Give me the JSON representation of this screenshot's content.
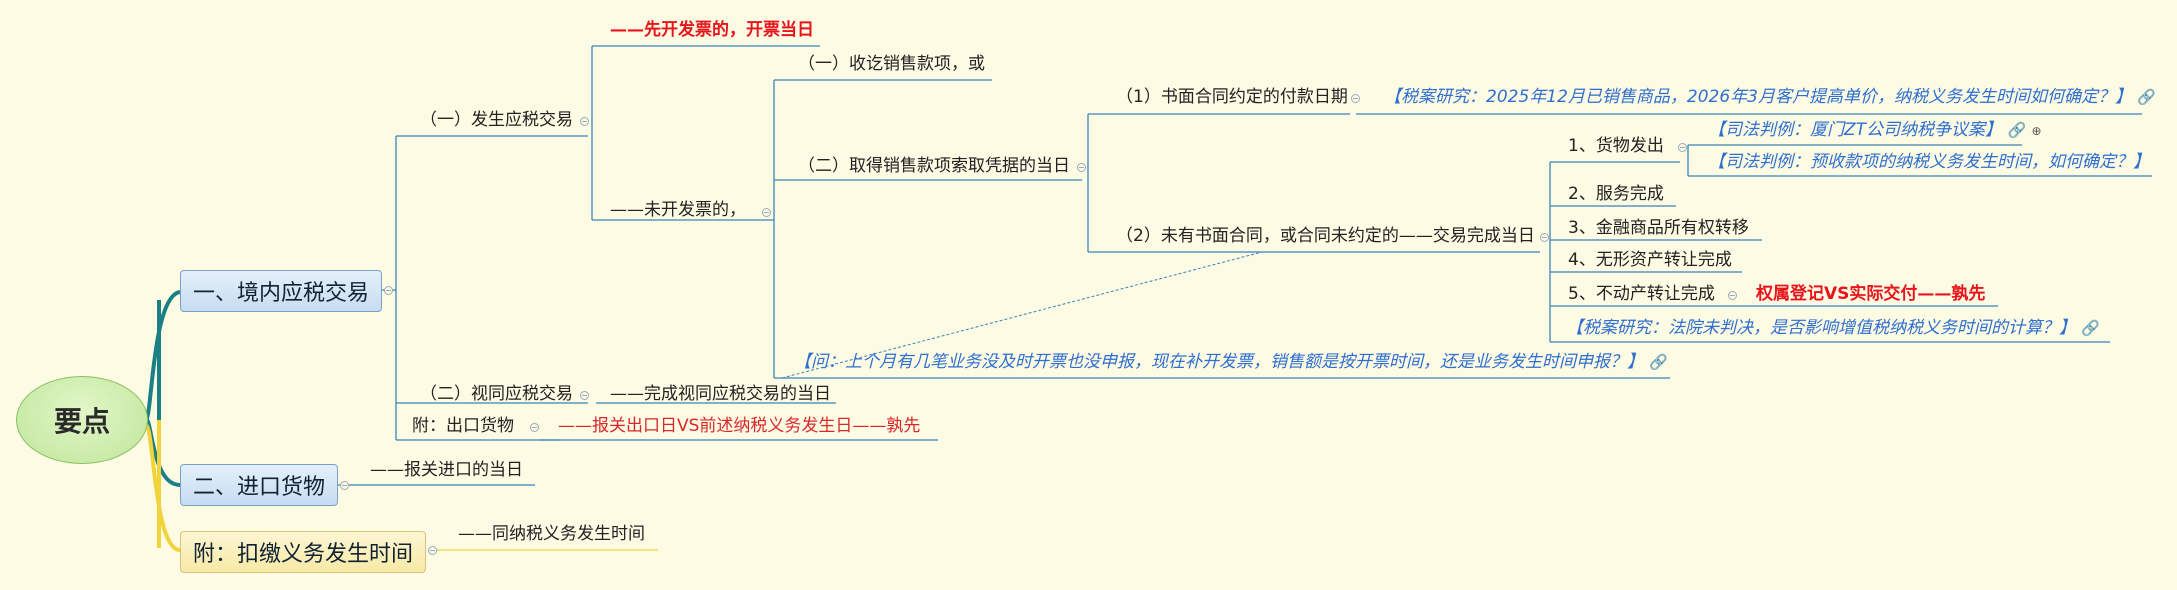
{
  "root": {
    "label": "要点"
  },
  "colors": {
    "blue_line": "#3b84b8",
    "teal_line": "#1b7f86",
    "yellow_line": "#f0d43a",
    "red": "#e8141c",
    "note_blue": "#2e6fd0"
  },
  "topics": {
    "domestic": "一、境内应税交易",
    "import": "二、进口货物",
    "withholding": "附：扣缴义务发生时间"
  },
  "domestic": {
    "occur": "（一）发生应税交易",
    "invoiced_first": "——先开发票的，开票当日",
    "not_invoiced": "——未开发票的，",
    "received": "（一）收讫销售款项，或",
    "obtained": "（二）取得销售款项索取凭据的当日",
    "written": "（1）书面合同约定的付款日期",
    "written_note": "【税案研究：2025年12月已销售商品，2026年3月客户提高单价，纳税义务发生时间如何确定？】",
    "no_written": "（2）未有书面合同，或合同未约定的——交易完成当日",
    "goods": "1、货物发出",
    "goods_note1": "【司法判例：厦门ZT公司纳税争议案】",
    "goods_note2": "【司法判例：预收款项的纳税义务发生时间，如何确定？】",
    "service": "2、服务完成",
    "finance": "3、金融商品所有权转移",
    "intangible": "4、无形资产转让完成",
    "realestate": "5、不动产转让完成",
    "realestate_red": "权属登记VS实际交付——孰先",
    "court_note": "【税案研究：法院未判决，是否影响增值税纳税义务时间的计算？】",
    "question": "【问：上个月有几笔业务没及时开票也没申报，现在补开发票，销售额是按开票时间，还是业务发生时间申报？】",
    "deemed": "（二）视同应税交易",
    "deemed_when": "——完成视同应税交易的当日",
    "export": "附：出口货物",
    "export_when": "——报关出口日VS前述纳税义务发生日——孰先"
  },
  "import": {
    "when": "——报关进口的当日"
  },
  "withholding": {
    "when": "——同纳税义务发生时间"
  }
}
